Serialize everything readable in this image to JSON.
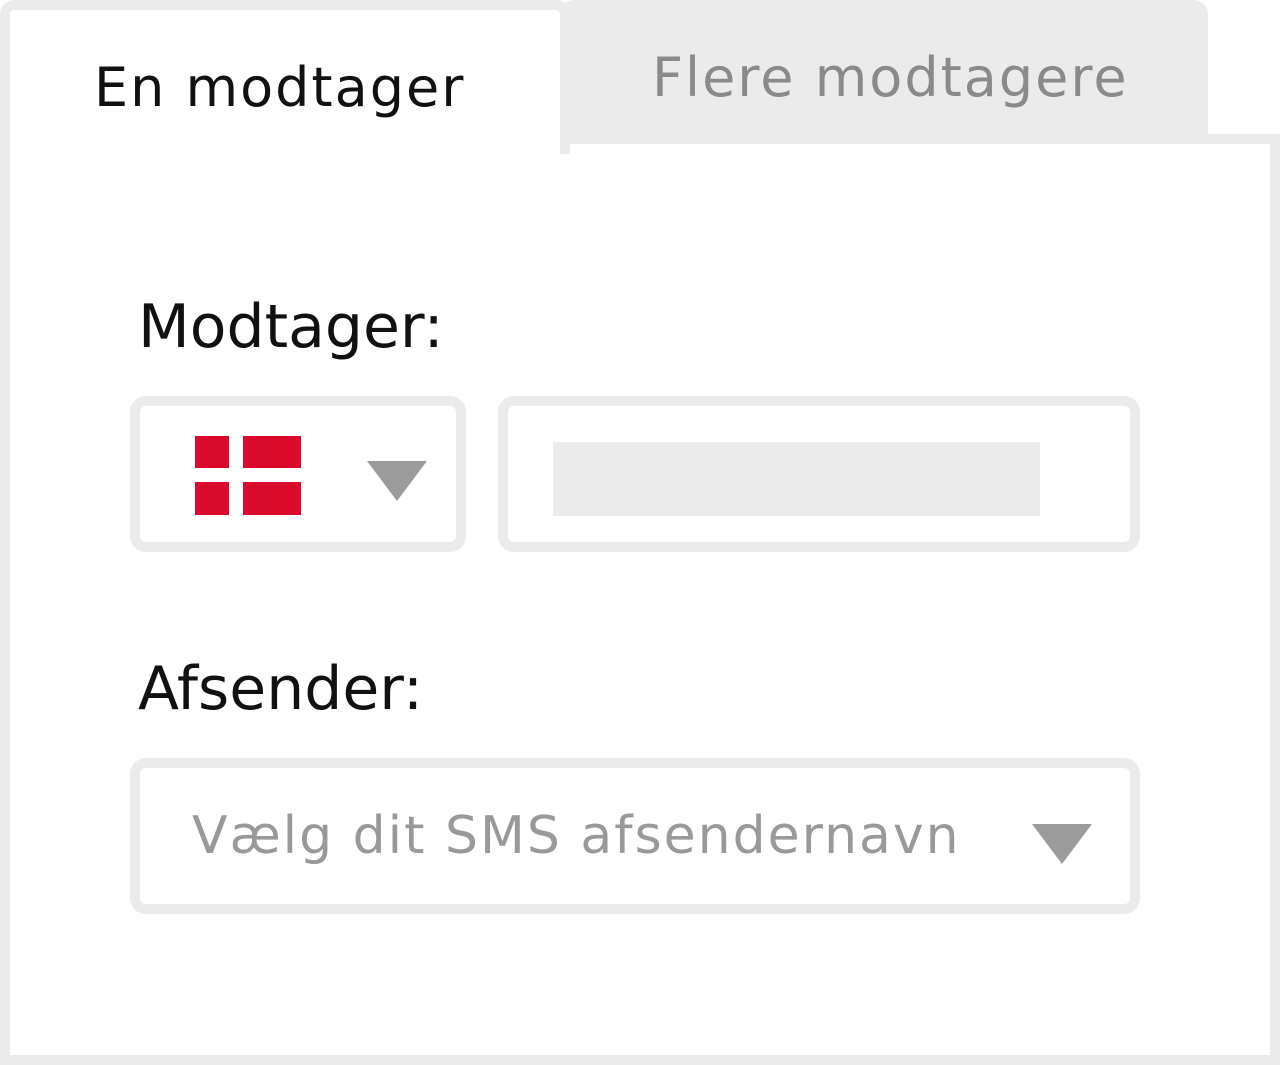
{
  "tabs": {
    "single": {
      "label": "En modtager",
      "active": true
    },
    "multiple": {
      "label": "Flere modtagere",
      "active": false
    }
  },
  "recipient": {
    "label": "Modtager:",
    "country": {
      "flag_icon": "denmark-flag-icon",
      "flag_color": "#d90a2c"
    },
    "phone_value": ""
  },
  "sender": {
    "label": "Afsender:",
    "placeholder": "Vælg dit SMS afsendernavn"
  },
  "colors": {
    "border": "#ebebeb",
    "inactive_text": "#8a8a8a",
    "placeholder_text": "#999999",
    "caret": "#9c9c9c"
  }
}
